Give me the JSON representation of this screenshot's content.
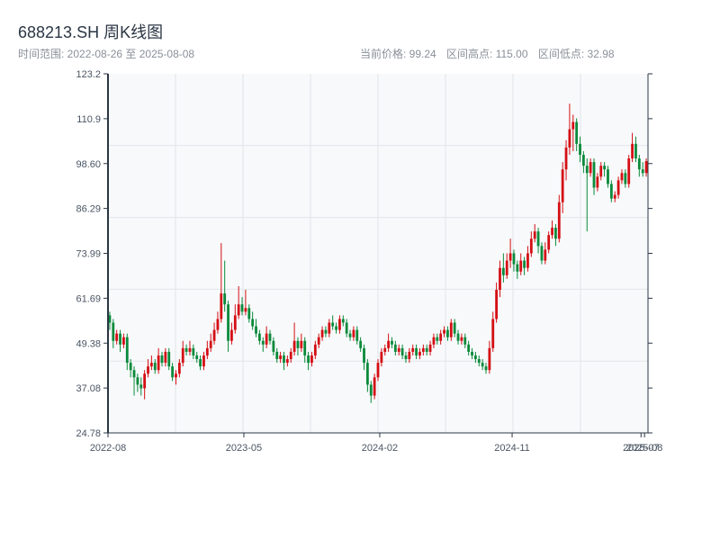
{
  "header": {
    "title": "688213.SH 周K线图",
    "range_label": "时间范围: 2022-08-26 至 2025-08-08",
    "current_price": "当前价格: 99.24",
    "range_high": "区间高点: 115.00",
    "range_low": "区间低点: 32.98"
  },
  "colors": {
    "up": "#d40f14",
    "down": "#0b8a3a",
    "axis": "#2b3644",
    "grid": "#e2e5ea",
    "bg": "#f7f9fb"
  },
  "chart_data": {
    "type": "candlestick",
    "title": "688213.SH 周K线图",
    "start_date": "2022-08-26",
    "end_date": "2025-08-08",
    "ylim": [
      24.78,
      123.2
    ],
    "y_ticks": [
      "123.2",
      "110.9",
      "98.60",
      "86.29",
      "73.99",
      "61.69",
      "49.38",
      "37.08",
      "24.78"
    ],
    "x_ticks": [
      {
        "label": "2022-08",
        "week": 0
      },
      {
        "label": "2023-05",
        "week": 39
      },
      {
        "label": "2024-02",
        "week": 78
      },
      {
        "label": "2024-11",
        "week": 116
      },
      {
        "label": "2025-07",
        "week": 153
      },
      {
        "label": "2025-08",
        "week": 154
      }
    ],
    "ohlc_fields": [
      "open",
      "high",
      "low",
      "close"
    ],
    "ohlc": [
      [
        57,
        58,
        53,
        55
      ],
      [
        55,
        56,
        48,
        50
      ],
      [
        50,
        53,
        49,
        52
      ],
      [
        52,
        53,
        47,
        49
      ],
      [
        49,
        52,
        48,
        51
      ],
      [
        51,
        52,
        42,
        44
      ],
      [
        44,
        45,
        40,
        42
      ],
      [
        42,
        43,
        35,
        40
      ],
      [
        40,
        41,
        36,
        38
      ],
      [
        38,
        40,
        35,
        37
      ],
      [
        37,
        42,
        34,
        41
      ],
      [
        41,
        45,
        40,
        43
      ],
      [
        43,
        46,
        42,
        44
      ],
      [
        44,
        45,
        41,
        42
      ],
      [
        42,
        48,
        41,
        46
      ],
      [
        46,
        47,
        43,
        44
      ],
      [
        44,
        48,
        43,
        47
      ],
      [
        47,
        48,
        42,
        43
      ],
      [
        43,
        44,
        39,
        40
      ],
      [
        40,
        42,
        38,
        41
      ],
      [
        41,
        45,
        40,
        44
      ],
      [
        44,
        50,
        43,
        48
      ],
      [
        48,
        49,
        46,
        47
      ],
      [
        47,
        50,
        46,
        48
      ],
      [
        48,
        49,
        45,
        46
      ],
      [
        46,
        47,
        44,
        45
      ],
      [
        45,
        46,
        42,
        43
      ],
      [
        43,
        47,
        42,
        46
      ],
      [
        46,
        50,
        45,
        48
      ],
      [
        48,
        52,
        47,
        50
      ],
      [
        50,
        55,
        49,
        53
      ],
      [
        53,
        58,
        52,
        56
      ],
      [
        56,
        76.8,
        55,
        63
      ],
      [
        63,
        72,
        58,
        60
      ],
      [
        60,
        61,
        47,
        50
      ],
      [
        50,
        55,
        49,
        53
      ],
      [
        53,
        60,
        52,
        57
      ],
      [
        57,
        65,
        56,
        60
      ],
      [
        60,
        62,
        57,
        58
      ],
      [
        58,
        64,
        57,
        59
      ],
      [
        59,
        60,
        55,
        56
      ],
      [
        56,
        58,
        53,
        54
      ],
      [
        54,
        56,
        51,
        52
      ],
      [
        52,
        53,
        49,
        50
      ],
      [
        50,
        51,
        47,
        49
      ],
      [
        49,
        54,
        48,
        52
      ],
      [
        52,
        53,
        49,
        50
      ],
      [
        50,
        51,
        46,
        47
      ],
      [
        47,
        48,
        44,
        45
      ],
      [
        45,
        47,
        44,
        46
      ],
      [
        46,
        47,
        42,
        44
      ],
      [
        44,
        46,
        43,
        45
      ],
      [
        45,
        48,
        44,
        47
      ],
      [
        47,
        55,
        46,
        50
      ],
      [
        50,
        51,
        46,
        48
      ],
      [
        48,
        52,
        47,
        50
      ],
      [
        50,
        51,
        44,
        46
      ],
      [
        46,
        47,
        42,
        44
      ],
      [
        44,
        47,
        43,
        46
      ],
      [
        46,
        50,
        45,
        49
      ],
      [
        49,
        52,
        48,
        51
      ],
      [
        51,
        54,
        50,
        53
      ],
      [
        53,
        54,
        51,
        52
      ],
      [
        52,
        56,
        51,
        55
      ],
      [
        55,
        57,
        53,
        54
      ],
      [
        54,
        55,
        52,
        53
      ],
      [
        53,
        57,
        52,
        56
      ],
      [
        56,
        57,
        54,
        55
      ],
      [
        55,
        56,
        51,
        52
      ],
      [
        52,
        53,
        50,
        51
      ],
      [
        51,
        54,
        50,
        53
      ],
      [
        53,
        54,
        49,
        50
      ],
      [
        50,
        51,
        47,
        48
      ],
      [
        48,
        49,
        42,
        44
      ],
      [
        44,
        45,
        36,
        38
      ],
      [
        38,
        39,
        32.98,
        35
      ],
      [
        35,
        41,
        34,
        40
      ],
      [
        40,
        45,
        39,
        44
      ],
      [
        44,
        48,
        43,
        47
      ],
      [
        47,
        49,
        46,
        48
      ],
      [
        48,
        52,
        47,
        50
      ],
      [
        50,
        51,
        48,
        49
      ],
      [
        49,
        50,
        46,
        47
      ],
      [
        47,
        49,
        46,
        48
      ],
      [
        48,
        49,
        45,
        46
      ],
      [
        46,
        47,
        44,
        45
      ],
      [
        45,
        48,
        44,
        47
      ],
      [
        47,
        49,
        46,
        48
      ],
      [
        48,
        49,
        45,
        46
      ],
      [
        46,
        48,
        45,
        47
      ],
      [
        47,
        49,
        46,
        48
      ],
      [
        48,
        49,
        46,
        47
      ],
      [
        47,
        50,
        46,
        49
      ],
      [
        49,
        52,
        48,
        51
      ],
      [
        51,
        52,
        49,
        50
      ],
      [
        50,
        53,
        49,
        52
      ],
      [
        52,
        54,
        51,
        53
      ],
      [
        53,
        54,
        50,
        51
      ],
      [
        51,
        56,
        50,
        55
      ],
      [
        55,
        56,
        51,
        52
      ],
      [
        52,
        53,
        49,
        50
      ],
      [
        50,
        52,
        49,
        51
      ],
      [
        51,
        52,
        48,
        49
      ],
      [
        49,
        50,
        46,
        47
      ],
      [
        47,
        48,
        45,
        46
      ],
      [
        46,
        47,
        44,
        45
      ],
      [
        45,
        46,
        43,
        44
      ],
      [
        44,
        45,
        42,
        43
      ],
      [
        43,
        44,
        41,
        42
      ],
      [
        42,
        50,
        41,
        48
      ],
      [
        48,
        58,
        47,
        56
      ],
      [
        56,
        66,
        55,
        64
      ],
      [
        64,
        72,
        62,
        70
      ],
      [
        70,
        74,
        66,
        68
      ],
      [
        68,
        74,
        67,
        72
      ],
      [
        72,
        78,
        70,
        74
      ],
      [
        74,
        75,
        69,
        71
      ],
      [
        71,
        72,
        67,
        69
      ],
      [
        69,
        74,
        68,
        72
      ],
      [
        72,
        73,
        68,
        70
      ],
      [
        70,
        76,
        69,
        74
      ],
      [
        74,
        80,
        73,
        78
      ],
      [
        78,
        82,
        77,
        80
      ],
      [
        80,
        81,
        74,
        76
      ],
      [
        76,
        77,
        71,
        72
      ],
      [
        72,
        77,
        71,
        75
      ],
      [
        75,
        80,
        74,
        79
      ],
      [
        79,
        83,
        78,
        81
      ],
      [
        81,
        82,
        76,
        78
      ],
      [
        78,
        90,
        77,
        88
      ],
      [
        88,
        99,
        85,
        97
      ],
      [
        97,
        105,
        94,
        103
      ],
      [
        103,
        115,
        101,
        108
      ],
      [
        108,
        112,
        102,
        110
      ],
      [
        110,
        111,
        102,
        104
      ],
      [
        104,
        106,
        99,
        101
      ],
      [
        101,
        102,
        96,
        98
      ],
      [
        98,
        100,
        80,
        96
      ],
      [
        96,
        100,
        95,
        99
      ],
      [
        99,
        100,
        90,
        92
      ],
      [
        92,
        96,
        91,
        95
      ],
      [
        95,
        99,
        94,
        98
      ],
      [
        98,
        99,
        95,
        97
      ],
      [
        97,
        98,
        92,
        93
      ],
      [
        93,
        94,
        88,
        89
      ],
      [
        89,
        91,
        88,
        90
      ],
      [
        90,
        95,
        89,
        94
      ],
      [
        94,
        97,
        93,
        96
      ],
      [
        96,
        97,
        92,
        93
      ],
      [
        93,
        101,
        92,
        100
      ],
      [
        100,
        107,
        99,
        104
      ],
      [
        104,
        106,
        99,
        100
      ],
      [
        100,
        101,
        95,
        97
      ],
      [
        97,
        99,
        95,
        96
      ],
      [
        96,
        100,
        95,
        99.24
      ]
    ]
  }
}
